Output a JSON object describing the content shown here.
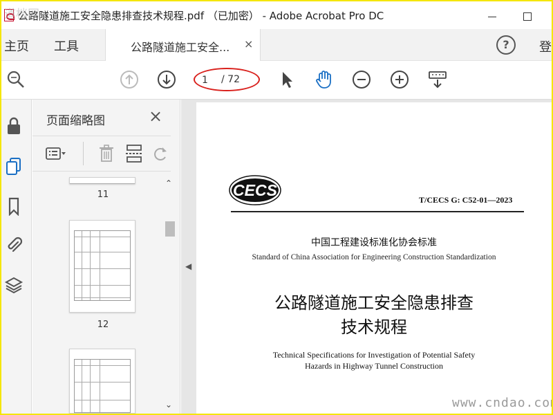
{
  "window": {
    "title": "公路隧道施工安全隐患排查技术规程.pdf （已加密） - Adobe Acrobat Pro DC"
  },
  "menu": {
    "home": "主页",
    "tools": "工具",
    "doc_tab": "公路隧道施工安全...",
    "doc_tab_close": "×",
    "help": "?",
    "login": "登"
  },
  "toolbar": {
    "page_current": "1",
    "page_total": "/ 72",
    "icons": [
      "search-zoom-icon",
      "prev-page-icon",
      "next-page-icon",
      "select-arrow-icon",
      "hand-tool-icon",
      "zoom-out-icon",
      "zoom-in-icon",
      "keyboard-scroll-icon"
    ]
  },
  "thumb_pane": {
    "title": "页面缩略图",
    "close": "×",
    "pages": [
      "11",
      "12"
    ]
  },
  "document": {
    "logo": "CECS",
    "standard_code": "T/CECS G: C52-01—2023",
    "org_cn": "中国工程建设标准化协会标准",
    "org_en": "Standard of China Association for Engineering Construction Standardization",
    "title_cn_1": "公路隧道施工安全隐患排查",
    "title_cn_2": "技术规程",
    "title_en_1": "Technical Specifications for Investigation of Potential Safety",
    "title_en_2": "Hazards in Highway Tunnel Construction"
  },
  "watermarks": {
    "bottom_right": "www.cndao.com",
    "top_left": "道档网"
  },
  "colors": {
    "border_frame": "#f5e600",
    "annotation_oval": "#d9201c",
    "acrobat_red": "#c8102e"
  }
}
